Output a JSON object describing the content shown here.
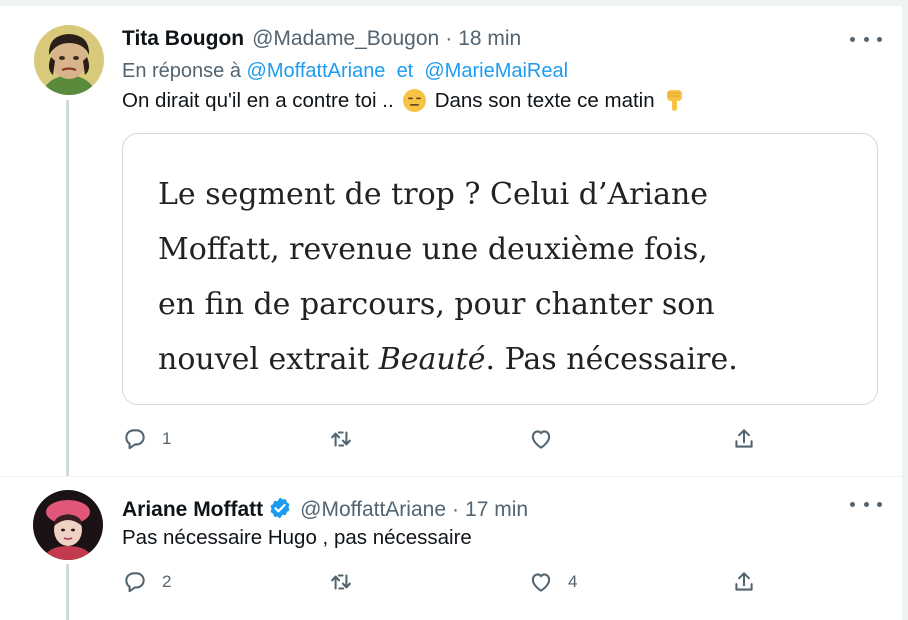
{
  "tweets": [
    {
      "name": "Tita Bougon",
      "handle": "@Madame_Bougon",
      "separator": "·",
      "time": "18 min",
      "reply_prefix": "En réponse à",
      "reply_mentions": [
        "@MoffattAriane",
        "et",
        "@MarieMaiReal"
      ],
      "text_part1": "On dirait qu'il en a contre toi ..",
      "text_part2": "Dans son texte ce matin",
      "emoji_1": "expressionless-face-emoji",
      "emoji_2": "backhand-index-pointing-down-emoji",
      "quote_image": {
        "line1": "Le segment de trop ? Celui d’Ariane",
        "line2": "Moffatt, revenue une deuxième fois,",
        "line3": "en fin de parcours, pour chanter son",
        "line4_a": "nouvel extrait ",
        "line4_italic": "Beauté",
        "line4_b": ". Pas nécessaire."
      },
      "actions": {
        "reply_count": "1",
        "retweet_count": "",
        "like_count": ""
      }
    },
    {
      "name": "Ariane Moffatt",
      "verified": true,
      "handle": "@MoffattAriane",
      "separator": "·",
      "time": "17 min",
      "text": "Pas nécessaire Hugo , pas nécessaire",
      "actions": {
        "reply_count": "2",
        "retweet_count": "",
        "like_count": "4"
      }
    }
  ],
  "colors": {
    "text": "#0f1419",
    "secondary": "#536471",
    "link": "#1d9bf0",
    "border": "#cfd9de",
    "verified": "#1d9bf0"
  }
}
